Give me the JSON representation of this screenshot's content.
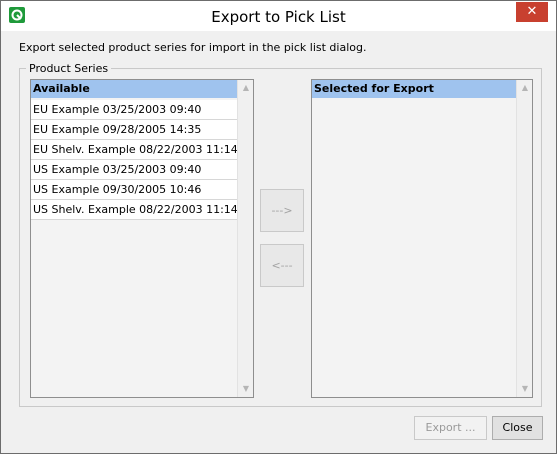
{
  "window": {
    "title": "Export to Pick List",
    "close_glyph": "✕",
    "app_icon": "app-logo-icon"
  },
  "instructions": "Export selected product series for import in the pick list dialog.",
  "group": {
    "title": "Product Series"
  },
  "available": {
    "header": "Available",
    "items": [
      "EU Example 03/25/2003 09:40",
      "EU Example 09/28/2005 14:35",
      "EU Shelv. Example 08/22/2003 11:14",
      "US Example 03/25/2003 09:40",
      "US Example 09/30/2005 10:46",
      "US Shelv. Example 08/22/2003 11:14"
    ]
  },
  "selected": {
    "header": "Selected for Export",
    "items": []
  },
  "transfer": {
    "add_label": "--->",
    "remove_label": "<---"
  },
  "footer": {
    "export_label": "Export ...",
    "close_label": "Close"
  },
  "colors": {
    "header_bg": "#9fc3ee",
    "close_bg": "#c8402f",
    "icon_bg": "#1f9a3a"
  }
}
